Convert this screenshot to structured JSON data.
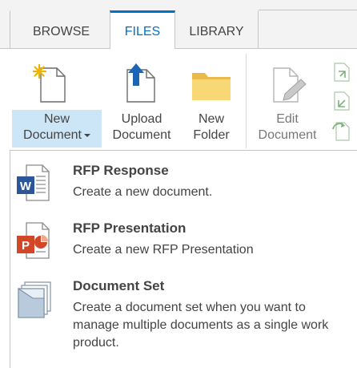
{
  "tabs": [
    {
      "label": "BROWSE"
    },
    {
      "label": "FILES"
    },
    {
      "label": "LIBRARY"
    }
  ],
  "selected_tab": "FILES",
  "ribbon": {
    "new_document": {
      "line1": "New",
      "line2": "Document",
      "icon": "new-document-icon"
    },
    "upload_document": {
      "line1": "Upload",
      "line2": "Document",
      "icon": "upload-document-icon"
    },
    "new_folder": {
      "line1": "New",
      "line2": "Folder",
      "icon": "folder-icon"
    },
    "edit_document": {
      "line1": "Edit",
      "line2": "Document",
      "icon": "edit-document-icon"
    }
  },
  "menu": {
    "items": [
      {
        "title": "RFP Response",
        "description": "Create a new document.",
        "icon": "word-document-icon"
      },
      {
        "title": "RFP Presentation",
        "description": "Create a new RFP Presentation",
        "icon": "powerpoint-document-icon"
      },
      {
        "title": "Document Set",
        "description": "Create a document set when you want to manage multiple documents as a single work product.",
        "icon": "document-set-icon"
      }
    ]
  },
  "colors": {
    "accent": "#0072c6",
    "highlight": "#cde6f7",
    "word": "#2b579a",
    "powerpoint": "#d24726",
    "folder": "#f8d775"
  }
}
